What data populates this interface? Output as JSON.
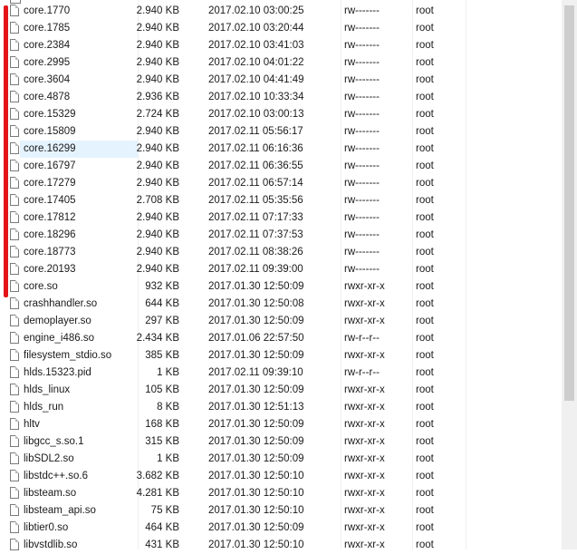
{
  "files": [
    {
      "name": "core.1770",
      "size": "2.940 KB",
      "modified": "2017.02.10 03:00:25",
      "permissions": "rw-------",
      "owner": "root"
    },
    {
      "name": "core.1785",
      "size": "2.940 KB",
      "modified": "2017.02.10 03:20:44",
      "permissions": "rw-------",
      "owner": "root"
    },
    {
      "name": "core.2384",
      "size": "2.940 KB",
      "modified": "2017.02.10 03:41:03",
      "permissions": "rw-------",
      "owner": "root"
    },
    {
      "name": "core.2995",
      "size": "2.940 KB",
      "modified": "2017.02.10 04:01:22",
      "permissions": "rw-------",
      "owner": "root"
    },
    {
      "name": "core.3604",
      "size": "2.940 KB",
      "modified": "2017.02.10 04:41:49",
      "permissions": "rw-------",
      "owner": "root"
    },
    {
      "name": "core.4878",
      "size": "2.936 KB",
      "modified": "2017.02.10 10:33:34",
      "permissions": "rw-------",
      "owner": "root"
    },
    {
      "name": "core.15329",
      "size": "2.724 KB",
      "modified": "2017.02.10 03:00:13",
      "permissions": "rw-------",
      "owner": "root"
    },
    {
      "name": "core.15809",
      "size": "2.940 KB",
      "modified": "2017.02.11 05:56:17",
      "permissions": "rw-------",
      "owner": "root"
    },
    {
      "name": "core.16299",
      "size": "2.940 KB",
      "modified": "2017.02.11 06:16:36",
      "permissions": "rw-------",
      "owner": "root",
      "selected": true
    },
    {
      "name": "core.16797",
      "size": "2.940 KB",
      "modified": "2017.02.11 06:36:55",
      "permissions": "rw-------",
      "owner": "root"
    },
    {
      "name": "core.17279",
      "size": "2.940 KB",
      "modified": "2017.02.11 06:57:14",
      "permissions": "rw-------",
      "owner": "root"
    },
    {
      "name": "core.17405",
      "size": "2.708 KB",
      "modified": "2017.02.11 05:35:56",
      "permissions": "rw-------",
      "owner": "root"
    },
    {
      "name": "core.17812",
      "size": "2.940 KB",
      "modified": "2017.02.11 07:17:33",
      "permissions": "rw-------",
      "owner": "root"
    },
    {
      "name": "core.18296",
      "size": "2.940 KB",
      "modified": "2017.02.11 07:37:53",
      "permissions": "rw-------",
      "owner": "root"
    },
    {
      "name": "core.18773",
      "size": "2.940 KB",
      "modified": "2017.02.11 08:38:26",
      "permissions": "rw-------",
      "owner": "root"
    },
    {
      "name": "core.20193",
      "size": "2.940 KB",
      "modified": "2017.02.11 09:39:00",
      "permissions": "rw-------",
      "owner": "root"
    },
    {
      "name": "core.so",
      "size": "932 KB",
      "modified": "2017.01.30 12:50:09",
      "permissions": "rwxr-xr-x",
      "owner": "root"
    },
    {
      "name": "crashhandler.so",
      "size": "644 KB",
      "modified": "2017.01.30 12:50:08",
      "permissions": "rwxr-xr-x",
      "owner": "root"
    },
    {
      "name": "demoplayer.so",
      "size": "297 KB",
      "modified": "2017.01.30 12:50:09",
      "permissions": "rwxr-xr-x",
      "owner": "root"
    },
    {
      "name": "engine_i486.so",
      "size": "2.434 KB",
      "modified": "2017.01.06 22:57:50",
      "permissions": "rw-r--r--",
      "owner": "root"
    },
    {
      "name": "filesystem_stdio.so",
      "size": "385 KB",
      "modified": "2017.01.30 12:50:09",
      "permissions": "rwxr-xr-x",
      "owner": "root"
    },
    {
      "name": "hlds.15323.pid",
      "size": "1 KB",
      "modified": "2017.02.11 09:39:10",
      "permissions": "rw-r--r--",
      "owner": "root"
    },
    {
      "name": "hlds_linux",
      "size": "105 KB",
      "modified": "2017.01.30 12:50:09",
      "permissions": "rwxr-xr-x",
      "owner": "root"
    },
    {
      "name": "hlds_run",
      "size": "8 KB",
      "modified": "2017.01.30 12:51:13",
      "permissions": "rwxr-xr-x",
      "owner": "root"
    },
    {
      "name": "hltv",
      "size": "168 KB",
      "modified": "2017.01.30 12:50:09",
      "permissions": "rwxr-xr-x",
      "owner": "root"
    },
    {
      "name": "libgcc_s.so.1",
      "size": "315 KB",
      "modified": "2017.01.30 12:50:09",
      "permissions": "rwxr-xr-x",
      "owner": "root"
    },
    {
      "name": "libSDL2.so",
      "size": "1 KB",
      "modified": "2017.01.30 12:50:09",
      "permissions": "rwxr-xr-x",
      "owner": "root"
    },
    {
      "name": "libstdc++.so.6",
      "size": "3.682 KB",
      "modified": "2017.01.30 12:50:10",
      "permissions": "rwxr-xr-x",
      "owner": "root"
    },
    {
      "name": "libsteam.so",
      "size": "4.281 KB",
      "modified": "2017.01.30 12:50:10",
      "permissions": "rwxr-xr-x",
      "owner": "root"
    },
    {
      "name": "libsteam_api.so",
      "size": "75 KB",
      "modified": "2017.01.30 12:50:10",
      "permissions": "rwxr-xr-x",
      "owner": "root"
    },
    {
      "name": "libtier0.so",
      "size": "464 KB",
      "modified": "2017.01.30 12:50:09",
      "permissions": "rwxr-xr-x",
      "owner": "root"
    },
    {
      "name": "libvstdlib.so",
      "size": "431 KB",
      "modified": "2017.01.30 12:50:10",
      "permissions": "rwxr-xr-x",
      "owner": "root"
    }
  ],
  "icons": {
    "file": "file-icon"
  },
  "colors": {
    "selection_highlight": "#e5f3ff",
    "annotation_mark": "#e3151a"
  }
}
